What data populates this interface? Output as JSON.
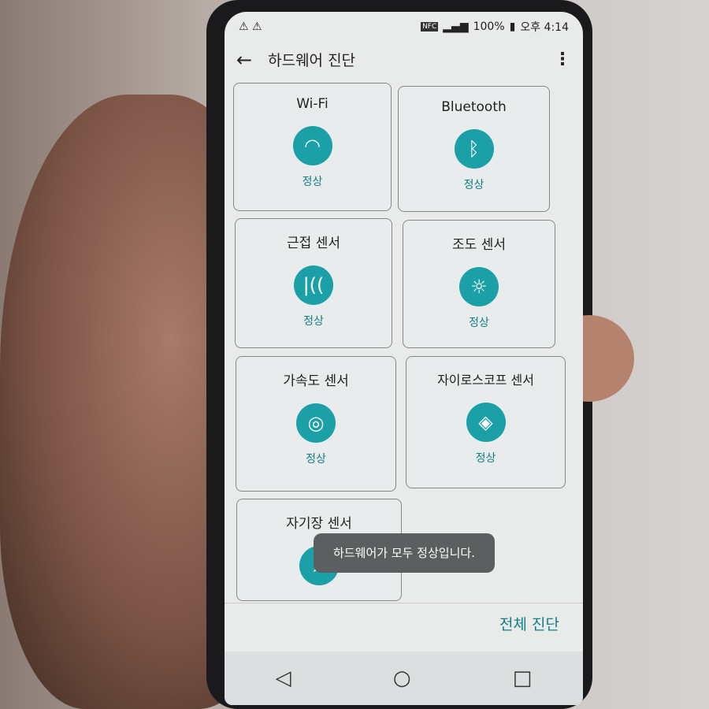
{
  "status": {
    "time": "오후 4:14",
    "battery": "100%",
    "nfc": "NFC",
    "warnings": [
      "warning-icon",
      "warning-icon"
    ]
  },
  "appbar": {
    "title": "하드웨어 진단"
  },
  "cards": [
    {
      "title": "Wi-Fi",
      "status": "정상",
      "icon": "wifi-icon"
    },
    {
      "title": "Bluetooth",
      "status": "정상",
      "icon": "bluetooth-icon"
    },
    {
      "title": "근접 센서",
      "status": "정상",
      "icon": "proximity-icon"
    },
    {
      "title": "조도 센서",
      "status": "정상",
      "icon": "light-bulb-icon"
    },
    {
      "title": "가속도 센서",
      "status": "정상",
      "icon": "accelerometer-icon"
    },
    {
      "title": "자이로스코프 센서",
      "status": "정상",
      "icon": "gyroscope-icon"
    },
    {
      "title": "자기장 센서",
      "icon": "compass-icon"
    }
  ],
  "toast": "하드웨어가 모두 정상입니다.",
  "footer": {
    "run_all": "전체 진단"
  },
  "colors": {
    "accent": "#1aa0a6",
    "status_text": "#117f86"
  }
}
